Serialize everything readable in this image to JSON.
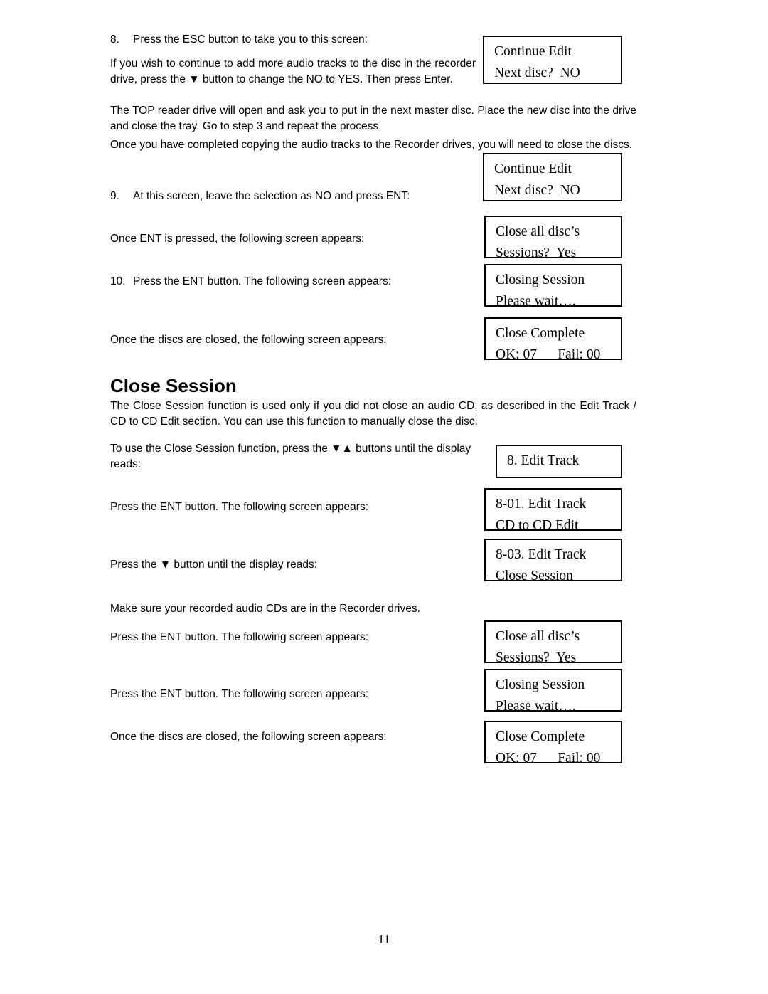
{
  "document": {
    "page_number": "11",
    "section_heading": "Close Session",
    "paragraphs": {
      "step8_num": "8.",
      "step8_text": "Press the ESC button to take you to this screen:",
      "step8_body": "If you wish to continue to add more audio tracks to the disc in the recorder drive, press the ▼ button to change the NO to YES.  Then press Enter.",
      "top_reader": "The TOP reader drive will open and ask you to put in the next master disc.  Place the new disc into the drive and close the tray.  Go to step 3 and repeat the process.",
      "completed_copy": "Once you have completed copying the audio tracks to the Recorder drives, you will need to close the discs.",
      "step9_num": "9.",
      "step9_text": "At this screen, leave the selection as NO and press ENT:",
      "once_ent": "Once ENT is pressed, the following screen appears:",
      "step10_num": "10.",
      "step10_text": "Press the ENT button.  The following screen appears:",
      "once_closed_1": "Once the discs are closed, the following screen appears:",
      "close_session_desc": "The Close Session function is used only if you did not close an audio CD, as described in the Edit Track / CD to CD Edit section.  You can use this function to manually close the disc.",
      "to_use": "To use the Close Session function, press the ▼▲ buttons until the display reads:",
      "press_ent_1": "Press the ENT button.  The following screen appears:",
      "press_down": "Press the ▼ button until the display reads:",
      "make_sure": "Make sure your recorded audio CDs are in the Recorder drives.",
      "press_ent_2": "Press the ENT button.  The following screen appears:",
      "press_ent_3": "Press the ENT button.  The following screen appears:",
      "once_closed_2": "Once the discs are closed, the following screen appears:"
    },
    "lcd_screens": {
      "continue_edit_1": {
        "line1": "Continue Edit",
        "line2": "Next disc?  NO"
      },
      "continue_edit_2": {
        "line1": "Continue Edit",
        "line2": "Next disc?  NO"
      },
      "close_all_1": {
        "line1": "Close all disc’s",
        "line2": "Sessions?  Yes"
      },
      "closing_session_1": {
        "line1": "Closing Session",
        "line2": "Please wait…."
      },
      "close_complete_1": {
        "line1": "Close Complete",
        "line2": "OK: 07      Fail: 00"
      },
      "edit_track": {
        "line1": "8. Edit Track",
        "line2": ""
      },
      "edit_track_801": {
        "line1": "8-01. Edit Track",
        "line2": "CD to CD Edit"
      },
      "edit_track_803": {
        "line1": "8-03. Edit Track",
        "line2": "Close Session"
      },
      "close_all_2": {
        "line1": "Close all disc’s",
        "line2": "Sessions?  Yes"
      },
      "closing_session_2": {
        "line1": "Closing Session",
        "line2": "Please wait…."
      },
      "close_complete_2": {
        "line1": "Close Complete",
        "line2": "OK: 07      Fail: 00"
      }
    }
  }
}
